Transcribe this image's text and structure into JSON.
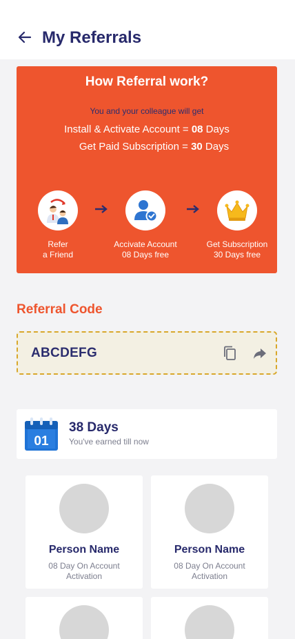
{
  "header": {
    "title": "My Referrals"
  },
  "hero": {
    "title": "How Referral work?",
    "subtitle": "You and your colleague will get",
    "line1": {
      "label": "Install & Activate Account = ",
      "value": "08",
      "unit": " Days"
    },
    "line2": {
      "label": "Get Paid Subscription = ",
      "value": "30",
      "unit": " Days"
    },
    "steps": [
      {
        "icon": "refer-friend-icon",
        "line1": "Refer",
        "line2": "a Friend"
      },
      {
        "icon": "activate-account-icon",
        "line1": "Accivate Account",
        "line2": "08 Days free"
      },
      {
        "icon": "crown-icon",
        "line1": "Get Subscription",
        "line2": "30 Days free"
      }
    ]
  },
  "referral": {
    "title": "Referral Code",
    "code": "ABCDEFG"
  },
  "earned": {
    "calendar_day": "01",
    "days": "38 Days",
    "subtitle": "You've earned till now"
  },
  "people": [
    {
      "name": "Person Name",
      "detail": "08 Day On Account Activation"
    },
    {
      "name": "Person Name",
      "detail": "08 Day On Account Activation"
    },
    {
      "name": "",
      "detail": ""
    },
    {
      "name": "",
      "detail": ""
    }
  ],
  "colors": {
    "accent": "#ee552e",
    "navy": "#27296b",
    "code_border": "#d8a72a",
    "code_bg": "#f3f0e3"
  }
}
